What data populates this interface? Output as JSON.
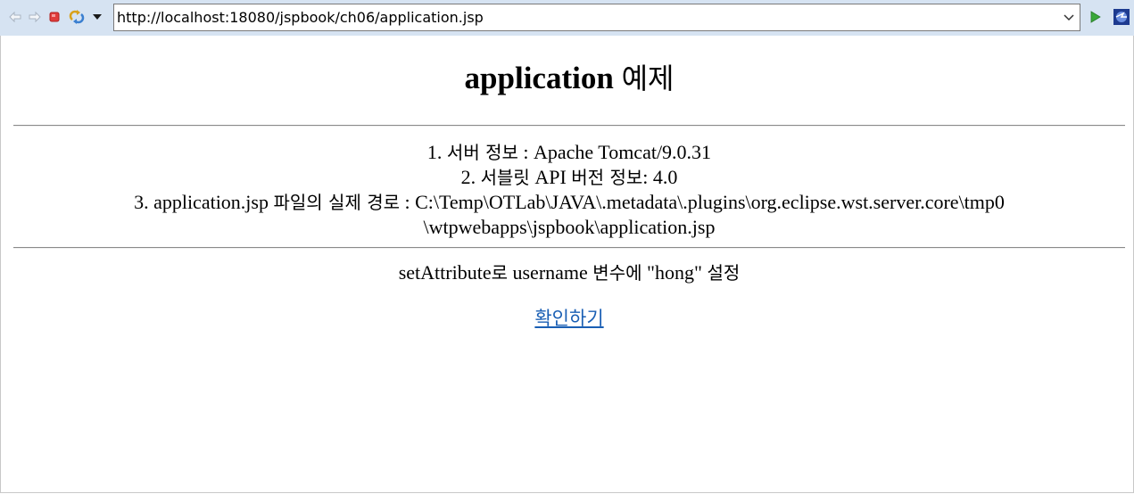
{
  "browser": {
    "url": "http://localhost:18080/jspbook/ch06/application.jsp",
    "icons": {
      "back": "back-arrow-icon",
      "forward": "forward-arrow-icon",
      "stop": "stop-icon",
      "refresh": "refresh-icon",
      "menu": "dropdown-menu-icon",
      "url_dropdown": "chevron-down-icon",
      "go": "go-play-icon",
      "eclipse": "eclipse-browser-icon"
    },
    "colors": {
      "toolbar_bg": "#d6e3f2",
      "go_green": "#3aa83a",
      "stop_red": "#e03c3c",
      "link_blue": "#1a5fb4"
    }
  },
  "page": {
    "heading_en": "application",
    "heading_ko": "예제",
    "info": {
      "line1_prefix": "1. ",
      "line1_ko": "서버 정보",
      "line1_suffix": " : Apache Tomcat/9.0.31",
      "line2_prefix": "2. ",
      "line2_ko1": "서블릿",
      "line2_mid": " API ",
      "line2_ko2": "버전 정보",
      "line2_suffix": ": 4.0",
      "line3_prefix": "3. application.jsp ",
      "line3_ko": "파일의 실제 경로",
      "line3_suffix": " : C:\\Temp\\OTLab\\JAVA\\.metadata\\.plugins\\org.eclipse.wst.server.core\\tmp0",
      "line4": "\\wtpwebapps\\jspbook\\application.jsp"
    },
    "set_text": {
      "part1": "setAttribute",
      "part2": "로",
      "part3": " username ",
      "part4": "변수에",
      "part5": " \"hong\" ",
      "part6": "설정"
    },
    "confirm_link": "확인하기"
  }
}
